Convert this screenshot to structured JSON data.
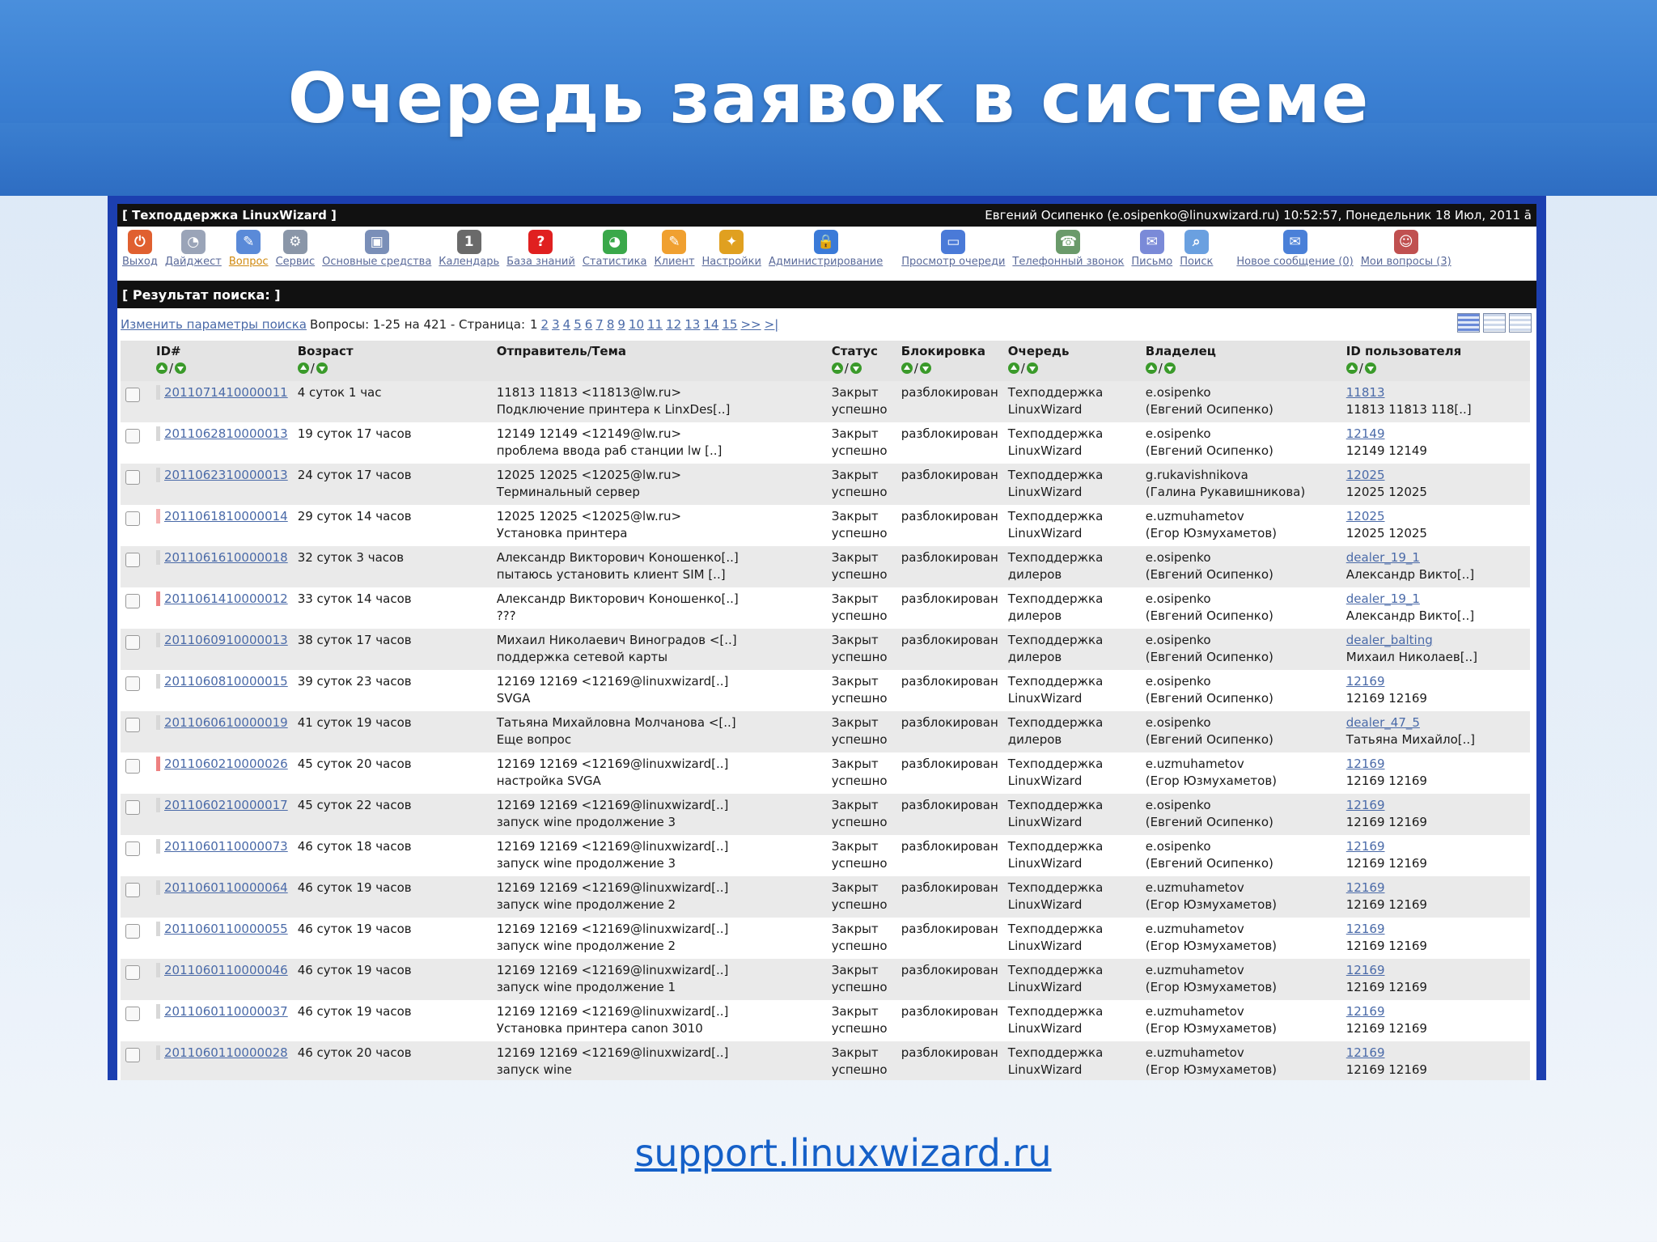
{
  "slide": {
    "title": "Очередь заявок в системе",
    "footer_link": "support.linuxwizard.ru"
  },
  "app": {
    "brand": "[ Техподдержка LinuxWizard ]",
    "user_info": "Евгений Осипенко (e.osipenko@linuxwizard.ru) 10:52:57, Понедельник 18 Июл, 2011 ā",
    "toolbar_left": [
      {
        "label": "Выход",
        "icon": "exit-icon",
        "color": "#e06030",
        "glyph": "⏻"
      },
      {
        "label": "Дайджест",
        "icon": "digest-icon",
        "color": "#9aa4b8",
        "glyph": "◔"
      },
      {
        "label": "Вопрос",
        "icon": "question-icon",
        "color": "#5a8ad8",
        "glyph": "✎",
        "active": true
      },
      {
        "label": "Сервис",
        "icon": "service-icon",
        "color": "#8a96a8",
        "glyph": "⚙"
      },
      {
        "label": "Основные средства",
        "icon": "assets-icon",
        "color": "#7a8fb8",
        "glyph": "▣"
      },
      {
        "label": "Календарь",
        "icon": "calendar-icon",
        "color": "#6a6a6a",
        "glyph": "1"
      },
      {
        "label": "База знаний",
        "icon": "knowledge-base-icon",
        "color": "#e02020",
        "glyph": "?"
      },
      {
        "label": "Статистика",
        "icon": "statistics-icon",
        "color": "#3aa84a",
        "glyph": "◕"
      },
      {
        "label": "Клиент",
        "icon": "client-icon",
        "color": "#f0a030",
        "glyph": "✎"
      },
      {
        "label": "Настройки",
        "icon": "settings-icon",
        "color": "#e0a020",
        "glyph": "✦"
      },
      {
        "label": "Администрирование",
        "icon": "admin-icon",
        "color": "#3a7ad8",
        "glyph": "🔒"
      }
    ],
    "toolbar_mid": [
      {
        "label": "Просмотр очереди",
        "icon": "queue-view-icon",
        "color": "#4a7ad8",
        "glyph": "▭"
      },
      {
        "label": "Телефонный звонок",
        "icon": "phone-call-icon",
        "color": "#6a9a6a",
        "glyph": "☎"
      },
      {
        "label": "Письмо",
        "icon": "mail-icon",
        "color": "#7a8ad8",
        "glyph": "✉"
      },
      {
        "label": "Поиск",
        "icon": "search-icon",
        "color": "#6aa0e0",
        "glyph": "⌕"
      }
    ],
    "toolbar_right": [
      {
        "label": "Новое сообщение (0)",
        "icon": "new-message-icon",
        "color": "#4a80d8",
        "glyph": "✉"
      },
      {
        "label": "Мои вопросы (3)",
        "icon": "my-questions-icon",
        "color": "#c05050",
        "glyph": "☺"
      }
    ],
    "section_title": "[ Результат поиска: ]",
    "nav": {
      "change_params": "Изменить параметры поиска",
      "summary": "Вопросы: 1-25 на 421 - Страница:",
      "current_page": "1",
      "pages": [
        "2",
        "3",
        "4",
        "5",
        "6",
        "7",
        "8",
        "9",
        "10",
        "11",
        "12",
        "13",
        "14",
        "15"
      ],
      "next": ">>",
      "last": ">|"
    },
    "columns": [
      "ID#",
      "Возраст",
      "Отправитель/Тема",
      "Статус",
      "Блокировка",
      "Очередь",
      "Владелец",
      "ID пользователя"
    ],
    "rows": [
      {
        "id": "2011071410000011",
        "mark": "none",
        "age": "4 суток 1 час",
        "from": "11813 11813 <11813@lw.ru>",
        "subject": "Подключение принтера к LinxDes[..]",
        "status1": "Закрыт",
        "status2": "успешно",
        "lock": "разблокирован",
        "queue1": "Техподдержка",
        "queue2": "LinuxWizard",
        "owner1": "e.osipenko",
        "owner2": "(Евгений Осипенко)",
        "uid": "11813",
        "uname": "11813 11813 118[..]"
      },
      {
        "id": "2011062810000013",
        "mark": "none",
        "age": "19 суток 17 часов",
        "from": "12149 12149 <12149@lw.ru>",
        "subject": "проблема ввода раб станции lw [..]",
        "status1": "Закрыт",
        "status2": "успешно",
        "lock": "разблокирован",
        "queue1": "Техподдержка",
        "queue2": "LinuxWizard",
        "owner1": "e.osipenko",
        "owner2": "(Евгений Осипенко)",
        "uid": "12149",
        "uname": "12149 12149"
      },
      {
        "id": "2011062310000013",
        "mark": "none",
        "age": "24 суток 17 часов",
        "from": "12025 12025 <12025@lw.ru>",
        "subject": "Терминальный сервер",
        "status1": "Закрыт",
        "status2": "успешно",
        "lock": "разблокирован",
        "queue1": "Техподдержка",
        "queue2": "LinuxWizard",
        "owner1": "g.rukavishnikova",
        "owner2": "(Галина Рукавишникова)",
        "uid": "12025",
        "uname": "12025 12025"
      },
      {
        "id": "2011061810000014",
        "mark": "pink",
        "age": "29 суток 14 часов",
        "from": "12025 12025 <12025@lw.ru>",
        "subject": "Установка принтера",
        "status1": "Закрыт",
        "status2": "успешно",
        "lock": "разблокирован",
        "queue1": "Техподдержка",
        "queue2": "LinuxWizard",
        "owner1": "e.uzmuhametov",
        "owner2": "(Егор Юзмухаметов)",
        "uid": "12025",
        "uname": "12025 12025"
      },
      {
        "id": "2011061610000018",
        "mark": "none",
        "age": "32 суток 3 часов",
        "from": "Александр Викторович Коношенко[..]",
        "subject": "пытаюсь установить клиент SIM [..]",
        "status1": "Закрыт",
        "status2": "успешно",
        "lock": "разблокирован",
        "queue1": "Техподдержка",
        "queue2": "дилеров",
        "owner1": "e.osipenko",
        "owner2": "(Евгений Осипенко)",
        "uid": "dealer_19_1",
        "uname": "Александр Викто[..]"
      },
      {
        "id": "2011061410000012",
        "mark": "red",
        "age": "33 суток 14 часов",
        "from": "Александр Викторович Коношенко[..]",
        "subject": "???",
        "status1": "Закрыт",
        "status2": "успешно",
        "lock": "разблокирован",
        "queue1": "Техподдержка",
        "queue2": "дилеров",
        "owner1": "e.osipenko",
        "owner2": "(Евгений Осипенко)",
        "uid": "dealer_19_1",
        "uname": "Александр Викто[..]"
      },
      {
        "id": "2011060910000013",
        "mark": "none",
        "age": "38 суток 17 часов",
        "from": "Михаил Николаевич Виноградов <[..]",
        "subject": "поддержка сетевой карты",
        "status1": "Закрыт",
        "status2": "успешно",
        "lock": "разблокирован",
        "queue1": "Техподдержка",
        "queue2": "дилеров",
        "owner1": "e.osipenko",
        "owner2": "(Евгений Осипенко)",
        "uid": "dealer_balting",
        "uname": "Михаил Николаев[..]"
      },
      {
        "id": "2011060810000015",
        "mark": "none",
        "age": "39 суток 23 часов",
        "from": "12169 12169 <12169@linuxwizard[..]",
        "subject": "SVGA",
        "status1": "Закрыт",
        "status2": "успешно",
        "lock": "разблокирован",
        "queue1": "Техподдержка",
        "queue2": "LinuxWizard",
        "owner1": "e.osipenko",
        "owner2": "(Евгений Осипенко)",
        "uid": "12169",
        "uname": "12169 12169"
      },
      {
        "id": "2011060610000019",
        "mark": "none",
        "age": "41 суток 19 часов",
        "from": "Татьяна Михайловна Молчанова <[..]",
        "subject": "Еще вопрос",
        "status1": "Закрыт",
        "status2": "успешно",
        "lock": "разблокирован",
        "queue1": "Техподдержка",
        "queue2": "дилеров",
        "owner1": "e.osipenko",
        "owner2": "(Евгений Осипенко)",
        "uid": "dealer_47_5",
        "uname": "Татьяна Михайло[..]"
      },
      {
        "id": "2011060210000026",
        "mark": "red",
        "age": "45 суток 20 часов",
        "from": "12169 12169 <12169@linuxwizard[..]",
        "subject": "настройка SVGA",
        "status1": "Закрыт",
        "status2": "успешно",
        "lock": "разблокирован",
        "queue1": "Техподдержка",
        "queue2": "LinuxWizard",
        "owner1": "e.uzmuhametov",
        "owner2": "(Егор Юзмухаметов)",
        "uid": "12169",
        "uname": "12169 12169"
      },
      {
        "id": "2011060210000017",
        "mark": "none",
        "age": "45 суток 22 часов",
        "from": "12169 12169 <12169@linuxwizard[..]",
        "subject": "запуск wine продолжение 3",
        "status1": "Закрыт",
        "status2": "успешно",
        "lock": "разблокирован",
        "queue1": "Техподдержка",
        "queue2": "LinuxWizard",
        "owner1": "e.osipenko",
        "owner2": "(Евгений Осипенко)",
        "uid": "12169",
        "uname": "12169 12169"
      },
      {
        "id": "2011060110000073",
        "mark": "none",
        "age": "46 суток 18 часов",
        "from": "12169 12169 <12169@linuxwizard[..]",
        "subject": "запуск wine продолжение 3",
        "status1": "Закрыт",
        "status2": "успешно",
        "lock": "разблокирован",
        "queue1": "Техподдержка",
        "queue2": "LinuxWizard",
        "owner1": "e.osipenko",
        "owner2": "(Евгений Осипенко)",
        "uid": "12169",
        "uname": "12169 12169"
      },
      {
        "id": "2011060110000064",
        "mark": "none",
        "age": "46 суток 19 часов",
        "from": "12169 12169 <12169@linuxwizard[..]",
        "subject": "запуск wine продолжение 2",
        "status1": "Закрыт",
        "status2": "успешно",
        "lock": "разблокирован",
        "queue1": "Техподдержка",
        "queue2": "LinuxWizard",
        "owner1": "e.uzmuhametov",
        "owner2": "(Егор Юзмухаметов)",
        "uid": "12169",
        "uname": "12169 12169"
      },
      {
        "id": "2011060110000055",
        "mark": "none",
        "age": "46 суток 19 часов",
        "from": "12169 12169 <12169@linuxwizard[..]",
        "subject": "запуск wine продолжение 2",
        "status1": "Закрыт",
        "status2": "успешно",
        "lock": "разблокирован",
        "queue1": "Техподдержка",
        "queue2": "LinuxWizard",
        "owner1": "e.uzmuhametov",
        "owner2": "(Егор Юзмухаметов)",
        "uid": "12169",
        "uname": "12169 12169"
      },
      {
        "id": "2011060110000046",
        "mark": "none",
        "age": "46 суток 19 часов",
        "from": "12169 12169 <12169@linuxwizard[..]",
        "subject": "запуск wine продолжение 1",
        "status1": "Закрыт",
        "status2": "успешно",
        "lock": "разблокирован",
        "queue1": "Техподдержка",
        "queue2": "LinuxWizard",
        "owner1": "e.uzmuhametov",
        "owner2": "(Егор Юзмухаметов)",
        "uid": "12169",
        "uname": "12169 12169"
      },
      {
        "id": "2011060110000037",
        "mark": "none",
        "age": "46 суток 19 часов",
        "from": "12169 12169 <12169@linuxwizard[..]",
        "subject": "Установка принтера canon 3010",
        "status1": "Закрыт",
        "status2": "успешно",
        "lock": "разблокирован",
        "queue1": "Техподдержка",
        "queue2": "LinuxWizard",
        "owner1": "e.uzmuhametov",
        "owner2": "(Егор Юзмухаметов)",
        "uid": "12169",
        "uname": "12169 12169"
      },
      {
        "id": "2011060110000028",
        "mark": "none",
        "age": "46 суток 20 часов",
        "from": "12169 12169 <12169@linuxwizard[..]",
        "subject": "запуск wine",
        "status1": "Закрыт",
        "status2": "успешно",
        "lock": "разблокирован",
        "queue1": "Техподдержка",
        "queue2": "LinuxWizard",
        "owner1": "e.uzmuhametov",
        "owner2": "(Егор Юзмухаметов)",
        "uid": "12169",
        "uname": "12169 12169"
      }
    ]
  }
}
